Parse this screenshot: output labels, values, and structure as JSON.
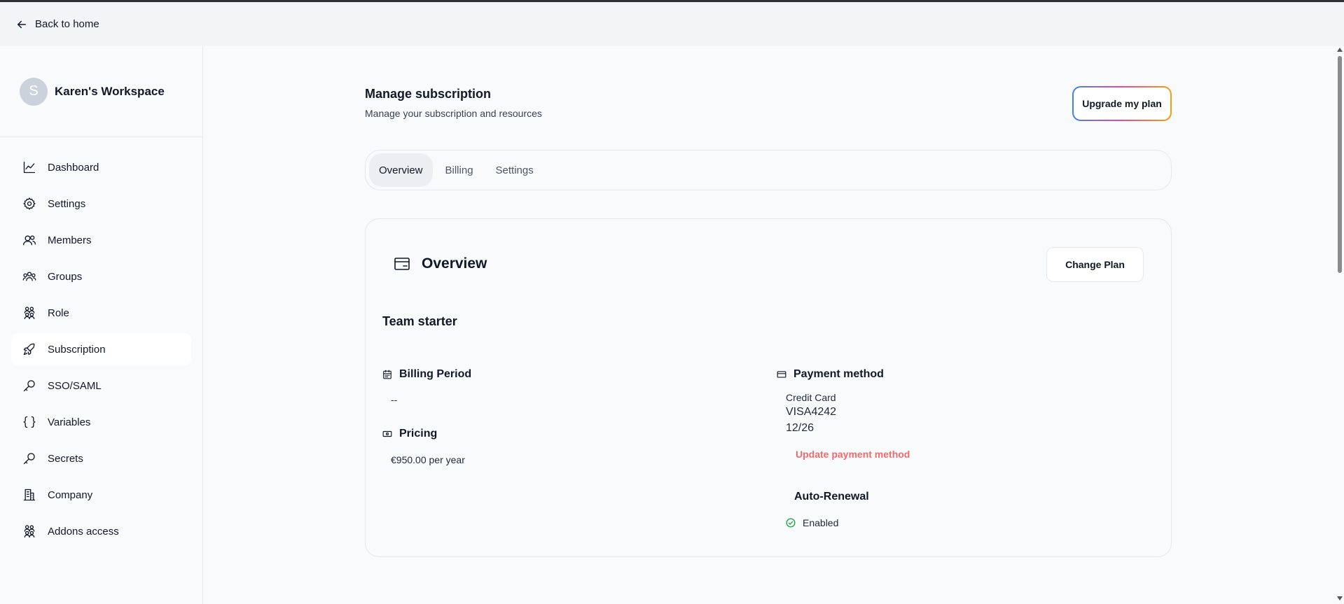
{
  "topbar": {
    "back_label": "Back to home"
  },
  "workspace": {
    "initial": "S",
    "name": "Karen's Workspace"
  },
  "sidebar": {
    "items": [
      {
        "label": "Dashboard",
        "icon": "chart-line-icon"
      },
      {
        "label": "Settings",
        "icon": "gear-icon"
      },
      {
        "label": "Members",
        "icon": "users-icon"
      },
      {
        "label": "Groups",
        "icon": "user-group-icon"
      },
      {
        "label": "Role",
        "icon": "role-icon"
      },
      {
        "label": "Subscription",
        "icon": "rocket-icon",
        "active": true
      },
      {
        "label": "SSO/SAML",
        "icon": "key-icon"
      },
      {
        "label": "Variables",
        "icon": "braces-icon"
      },
      {
        "label": "Secrets",
        "icon": "key-icon"
      },
      {
        "label": "Company",
        "icon": "building-icon"
      },
      {
        "label": "Addons access",
        "icon": "role-icon"
      }
    ]
  },
  "header": {
    "title": "Manage subscription",
    "subtitle": "Manage your subscription and resources",
    "upgrade_label": "Upgrade my plan"
  },
  "tabs": [
    {
      "label": "Overview",
      "active": true
    },
    {
      "label": "Billing"
    },
    {
      "label": "Settings"
    }
  ],
  "overview": {
    "title": "Overview",
    "change_plan_label": "Change Plan",
    "plan_name": "Team starter",
    "billing_period_label": "Billing Period",
    "billing_period_value": "--",
    "pricing_label": "Pricing",
    "pricing_value": "€950.00 per year",
    "payment_method_label": "Payment method",
    "payment_type": "Credit Card",
    "card_number": "VISA4242",
    "card_expiry": "12/26",
    "update_payment_label": "Update payment method",
    "auto_renewal_label": "Auto-Renewal",
    "auto_renewal_status": "Enabled"
  },
  "colors": {
    "danger_link": "#ef6b6b",
    "success": "#16a34a",
    "upgrade_gradient": [
      "#3b82f6",
      "#ec4899",
      "#f59e0b"
    ]
  }
}
